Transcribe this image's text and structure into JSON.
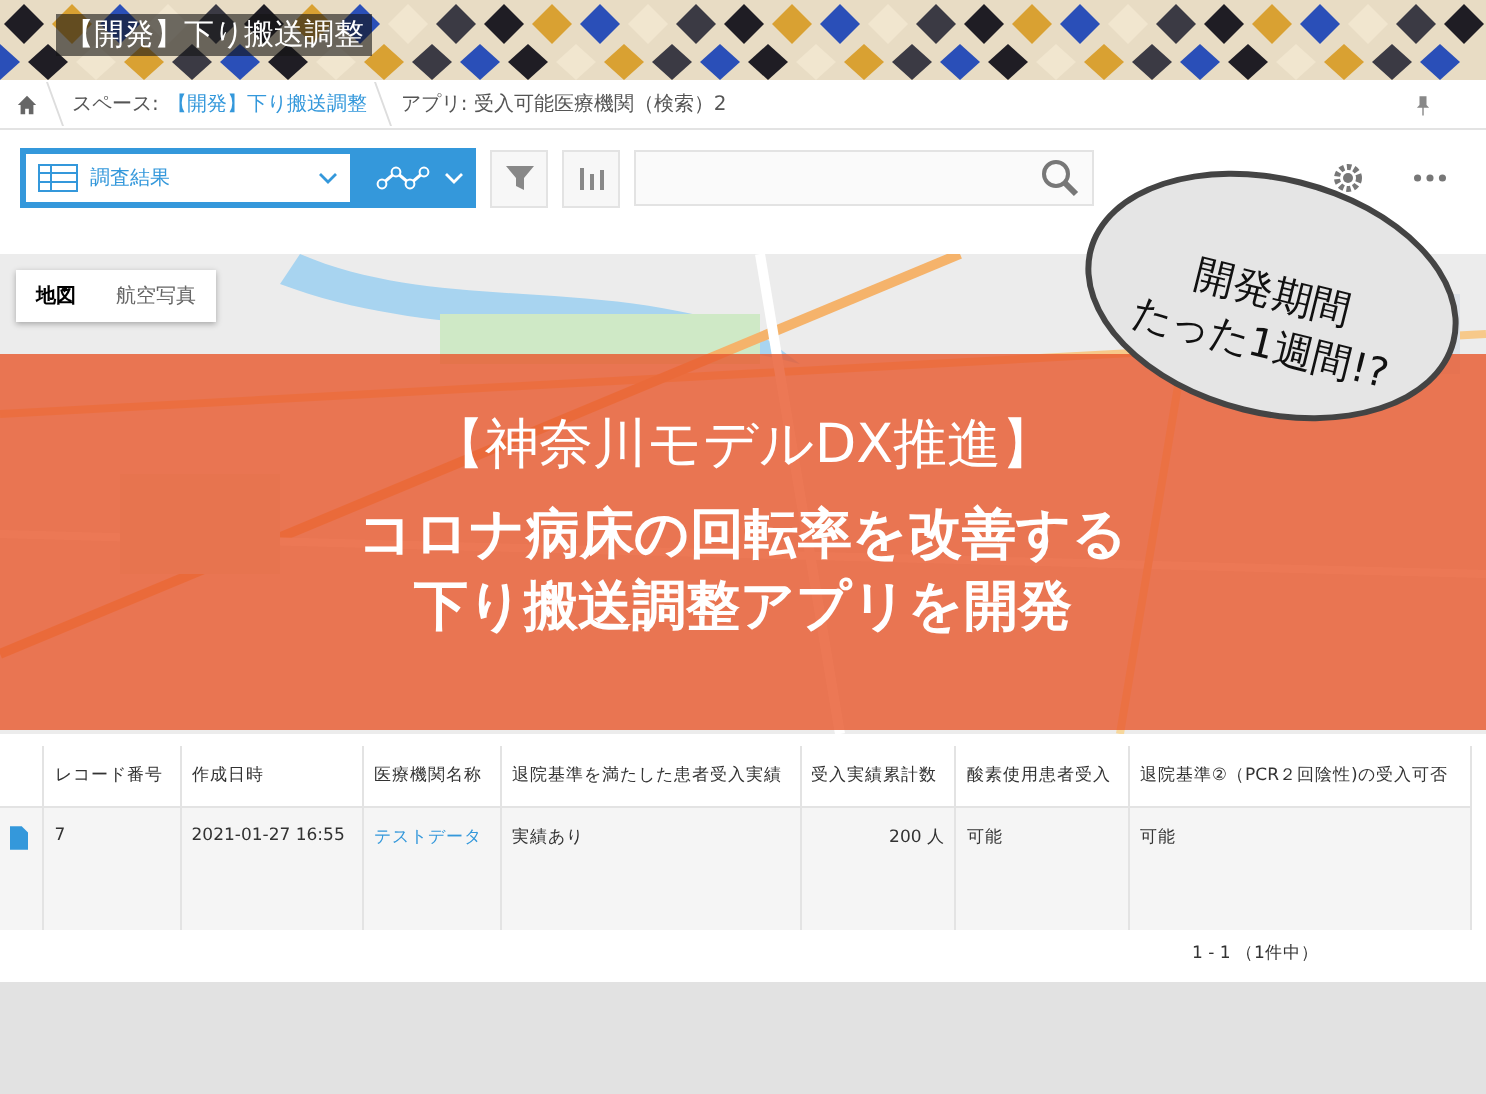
{
  "header": {
    "title": "【開発】下り搬送調整"
  },
  "breadcrumb": {
    "space_label": "スペース:",
    "space_link": "【開発】下り搬送調整",
    "app": "アプリ: 受入可能医療機関（検索）2"
  },
  "toolbar": {
    "view": "調査結果"
  },
  "map": {
    "tabs": [
      {
        "label": "地図",
        "selected": true
      },
      {
        "label": "航空写真",
        "selected": false
      }
    ]
  },
  "banner": {
    "tag": "【神奈川モデルDX推進】",
    "lines": [
      "コロナ病床の回転率を改善する",
      "下り搬送調整アプリを開発"
    ]
  },
  "bubble": {
    "lines": [
      "開発期間",
      "たった1週間!?"
    ]
  },
  "table": {
    "columns": [
      "レコード番号",
      "作成日時",
      "医療機関名称",
      "退院基準を満たした患者受入実績",
      "受入実績累計数",
      "酸素使用患者受入",
      "退院基準②（PCR２回陰性)の受入可否"
    ],
    "rows": [
      {
        "cells": [
          {
            "text": "7",
            "kind": "text"
          },
          {
            "text": "2021-01-27 16:55",
            "kind": "text"
          },
          {
            "text": "テストデータ",
            "kind": "link"
          },
          {
            "text": "実績あり",
            "kind": "text"
          },
          {
            "text": "200 人",
            "kind": "number"
          },
          {
            "text": "可能",
            "kind": "text"
          },
          {
            "text": "可能",
            "kind": "text"
          }
        ]
      }
    ]
  },
  "pagination": "1 - 1 （1件中）"
}
